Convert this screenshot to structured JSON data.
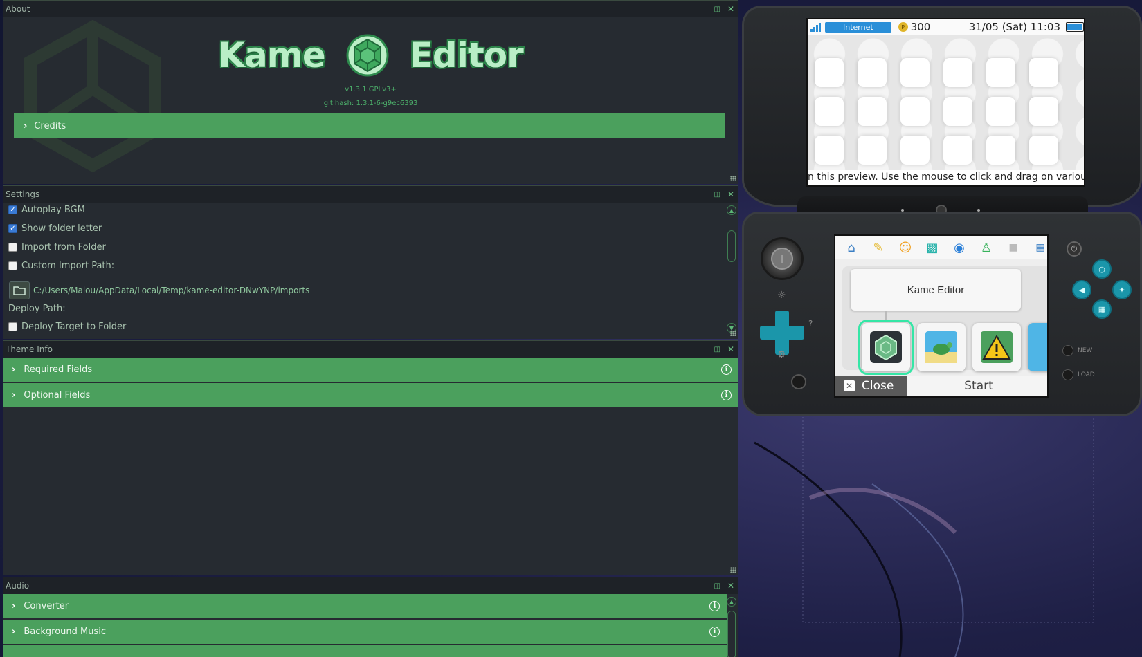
{
  "about": {
    "title": "About",
    "logo_left": "Kame",
    "logo_right": "Editor",
    "version": "v1.3.1 GPLv3+",
    "git_hash": "git hash: 1.3.1-6-g9ec6393",
    "credits": "Credits"
  },
  "settings": {
    "title": "Settings",
    "options": [
      {
        "label": "Autoplay BGM",
        "checked": true
      },
      {
        "label": "Show folder letter",
        "checked": true
      },
      {
        "label": "Import from Folder",
        "checked": false
      },
      {
        "label": "Custom Import Path:",
        "checked": false
      }
    ],
    "import_path": "C:/Users/Malou/AppData/Local/Temp/kame-editor-DNwYNP/imports",
    "deploy_path_label": "Deploy Path:",
    "deploy_target": {
      "label": "Deploy Target to Folder",
      "checked": false
    }
  },
  "theme_info": {
    "title": "Theme Info",
    "sections": [
      "Required Fields",
      "Optional Fields"
    ]
  },
  "audio": {
    "title": "Audio",
    "sections": [
      "Converter",
      "Background Music"
    ]
  },
  "preview": {
    "status_internet": "Internet",
    "coins": "300",
    "datetime": "31/05 (Sat) 11:03",
    "ticker": "n this preview. Use the mouse to click and drag on variou",
    "app_title": "Kame Editor",
    "close_label": "Close",
    "start_label": "Start",
    "new_label": "NEW",
    "load_label": "LOAD",
    "accent_color": "#1b96aa",
    "panel_green": "#4ba05d"
  }
}
